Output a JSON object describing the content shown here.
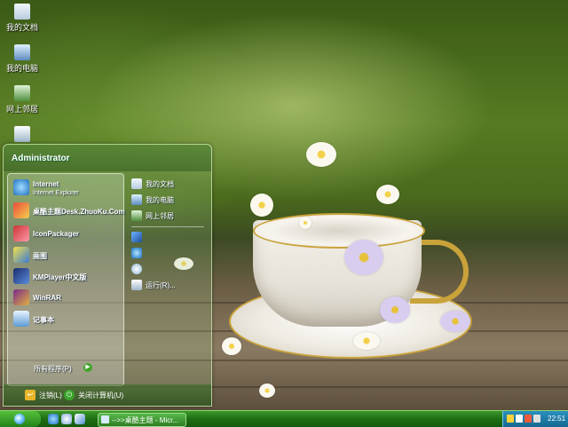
{
  "desktop": {
    "icons": [
      {
        "label": "我的文档",
        "icon": "my-documents-icon"
      },
      {
        "label": "我的电脑",
        "icon": "my-computer-icon"
      },
      {
        "label": "网上邻居",
        "icon": "network-places-icon"
      },
      {
        "label": "",
        "icon": "recycle-bin-icon"
      }
    ]
  },
  "start_menu": {
    "user": "Administrator",
    "pinned": [
      {
        "name": "Internet",
        "sub": "Internet Explorer",
        "icon": "internet-explorer-icon"
      },
      {
        "name": "桌酷主题Desk.ZhuoKu.Com",
        "sub": "",
        "icon": "zhuoku-theme-icon"
      }
    ],
    "recent": [
      {
        "name": "IconPackager",
        "icon": "iconpackager-icon"
      },
      {
        "name": "画图",
        "icon": "paint-icon"
      },
      {
        "name": "KMPlayer中文版",
        "icon": "kmplayer-icon"
      },
      {
        "name": "WinRAR",
        "icon": "winrar-icon"
      },
      {
        "name": "记事本",
        "icon": "notepad-icon"
      }
    ],
    "all_programs": "所有程序(P)",
    "places": [
      {
        "name": "我的文档",
        "icon": "my-documents-icon"
      },
      {
        "name": "我的电脑",
        "icon": "my-computer-icon"
      },
      {
        "name": "网上邻居",
        "icon": "network-places-icon"
      },
      {
        "name": "",
        "icon": "control-panel-icon"
      },
      {
        "name": "",
        "icon": "help-icon"
      },
      {
        "name": "",
        "icon": "search-icon"
      },
      {
        "name": "运行(R)...",
        "icon": "run-icon"
      }
    ],
    "logoff": "注销(L)",
    "shutdown": "关闭计算机(U)"
  },
  "taskbar": {
    "task": "-->>桌酷主题 - Micr...",
    "clock": "22:51"
  },
  "colors": {
    "taskbar": "#1f6d14",
    "tray": "#16698f",
    "cup_gold": "#c9a23a"
  }
}
